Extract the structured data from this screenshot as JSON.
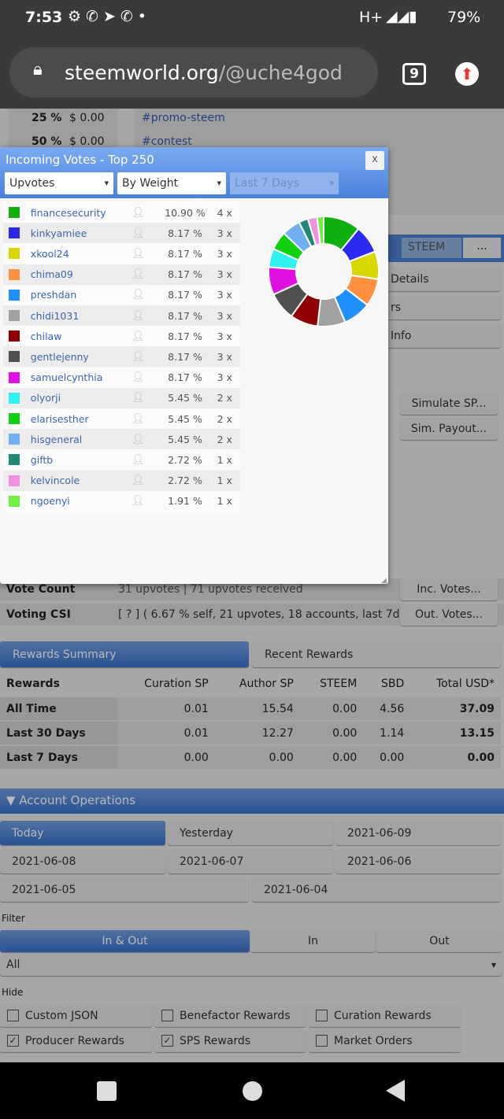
{
  "status": {
    "time": "7:53",
    "network": "H+",
    "battery": "79%"
  },
  "browser": {
    "url_domain": "steemworld.org",
    "url_path": "/@uche4god",
    "tab_count": "9"
  },
  "background": {
    "pct_rows": [
      {
        "pct": "25 %",
        "val": "$ 0.00"
      },
      {
        "pct": "50 %",
        "val": "$ 0.00"
      }
    ],
    "tags": [
      "#promo-steem",
      "#contest"
    ],
    "currency_select": "STEEM",
    "more_btn": "...",
    "side_buttons": [
      "Details",
      "rs",
      "Info"
    ],
    "simulate_sp": "Simulate SP...",
    "sim_payout": "Sim. Payout...",
    "vote_count_label": "Vote Count",
    "vote_count_value": "31 upvotes | 71 upvotes received",
    "inc_votes": "Inc. Votes...",
    "voting_csi_label": "Voting CSI",
    "voting_csi_value": "[ ? ] ( 6.67 % self, 21 upvotes, 18 accounts, last 7d )",
    "out_votes": "Out. Votes..."
  },
  "rewards": {
    "tab_active": "Rewards Summary",
    "tab_other": "Recent Rewards",
    "headers": [
      "Rewards",
      "Curation SP",
      "Author SP",
      "STEEM",
      "SBD",
      "Total USD*"
    ],
    "rows": [
      [
        "All Time",
        "0.01",
        "15.54",
        "0.00",
        "4.56",
        "37.09"
      ],
      [
        "Last 30 Days",
        "0.01",
        "12.27",
        "0.00",
        "1.14",
        "13.15"
      ],
      [
        "Last 7 Days",
        "0.00",
        "0.00",
        "0.00",
        "0.00",
        "0.00"
      ]
    ]
  },
  "operations": {
    "title": "Account Operations",
    "dates": [
      "Today",
      "Yesterday",
      "2021-06-09",
      "2021-06-08",
      "2021-06-07",
      "2021-06-06",
      "2021-06-05",
      "2021-06-04"
    ],
    "filter_label": "Filter",
    "filter_tabs": [
      "In & Out",
      "In",
      "Out"
    ],
    "type_select": "All",
    "hide_label": "Hide",
    "hide_options": [
      {
        "label": "Custom JSON",
        "checked": false
      },
      {
        "label": "Benefactor Rewards",
        "checked": false
      },
      {
        "label": "Curation Rewards",
        "checked": false
      },
      {
        "label": "Producer Rewards",
        "checked": true
      },
      {
        "label": "SPS Rewards",
        "checked": true
      },
      {
        "label": "Market Orders",
        "checked": false
      }
    ]
  },
  "modal": {
    "title": "Incoming Votes - Top 250",
    "close": "x",
    "type_select": "Upvotes",
    "sort_select": "By Weight",
    "period_select": "Last 7 Days",
    "voters": [
      {
        "name": "financesecurity",
        "pct": "10.90 %",
        "count": "4 x",
        "value": 10.9,
        "color": "#10b010"
      },
      {
        "name": "kinkyamiee",
        "pct": "8.17 %",
        "count": "3 x",
        "value": 8.17,
        "color": "#2a2af0"
      },
      {
        "name": "xkool24",
        "pct": "8.17 %",
        "count": "3 x",
        "value": 8.17,
        "color": "#d8d800"
      },
      {
        "name": "chima09",
        "pct": "8.17 %",
        "count": "3 x",
        "value": 8.17,
        "color": "#ff9040"
      },
      {
        "name": "preshdan",
        "pct": "8.17 %",
        "count": "3 x",
        "value": 8.17,
        "color": "#2090ff"
      },
      {
        "name": "chidi1031",
        "pct": "8.17 %",
        "count": "3 x",
        "value": 8.17,
        "color": "#a0a0a0"
      },
      {
        "name": "chilaw",
        "pct": "8.17 %",
        "count": "3 x",
        "value": 8.17,
        "color": "#900000"
      },
      {
        "name": "gentlejenny",
        "pct": "8.17 %",
        "count": "3 x",
        "value": 8.17,
        "color": "#505050"
      },
      {
        "name": "samuelcynthia",
        "pct": "8.17 %",
        "count": "3 x",
        "value": 8.17,
        "color": "#e010e0"
      },
      {
        "name": "olyorji",
        "pct": "5.45 %",
        "count": "2 x",
        "value": 5.45,
        "color": "#30f0f0"
      },
      {
        "name": "elarisesther",
        "pct": "5.45 %",
        "count": "2 x",
        "value": 5.45,
        "color": "#10d010"
      },
      {
        "name": "hisgeneral",
        "pct": "5.45 %",
        "count": "2 x",
        "value": 5.45,
        "color": "#70b0f0"
      },
      {
        "name": "giftb",
        "pct": "2.72 %",
        "count": "1 x",
        "value": 2.72,
        "color": "#208878"
      },
      {
        "name": "kelvincole",
        "pct": "2.72 %",
        "count": "1 x",
        "value": 2.72,
        "color": "#f090e0"
      },
      {
        "name": "ngoenyi",
        "pct": "1.91 %",
        "count": "1 x",
        "value": 1.91,
        "color": "#70f040"
      }
    ]
  }
}
